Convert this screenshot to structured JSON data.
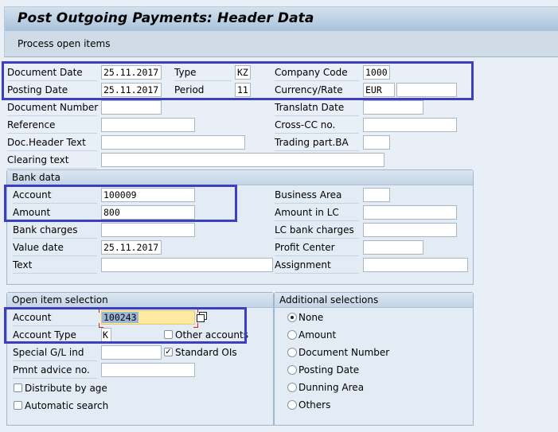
{
  "title": "Post Outgoing Payments: Header Data",
  "toolbar": {
    "process_open_items": "Process open items"
  },
  "header": {
    "document_date": {
      "label": "Document Date",
      "value": "25.11.2017"
    },
    "posting_date": {
      "label": "Posting Date",
      "value": "25.11.2017"
    },
    "type": {
      "label": "Type",
      "value": "KZ"
    },
    "period": {
      "label": "Period",
      "value": "11"
    },
    "company_code": {
      "label": "Company Code",
      "value": "1000"
    },
    "currency_rate": {
      "label": "Currency/Rate",
      "currency": "EUR",
      "rate": ""
    },
    "document_number": {
      "label": "Document Number",
      "value": ""
    },
    "translatn_date": {
      "label": "Translatn Date",
      "value": ""
    },
    "reference": {
      "label": "Reference",
      "value": ""
    },
    "cross_cc_no": {
      "label": "Cross-CC no.",
      "value": ""
    },
    "doc_header_text": {
      "label": "Doc.Header Text",
      "value": ""
    },
    "trading_part_ba": {
      "label": "Trading part.BA",
      "value": ""
    },
    "clearing_text": {
      "label": "Clearing text",
      "value": ""
    }
  },
  "bank_data": {
    "title": "Bank data",
    "account": {
      "label": "Account",
      "value": "100009"
    },
    "amount": {
      "label": "Amount",
      "value": "800"
    },
    "bank_charges": {
      "label": "Bank charges",
      "value": ""
    },
    "value_date": {
      "label": "Value date",
      "value": "25.11.2017"
    },
    "text": {
      "label": "Text",
      "value": ""
    },
    "business_area": {
      "label": "Business Area",
      "value": ""
    },
    "amount_in_lc": {
      "label": "Amount in LC",
      "value": ""
    },
    "lc_bank_charges": {
      "label": "LC bank charges",
      "value": ""
    },
    "profit_center": {
      "label": "Profit Center",
      "value": ""
    },
    "assignment": {
      "label": "Assignment",
      "value": ""
    }
  },
  "open_item_selection": {
    "title": "Open item selection",
    "account": {
      "label": "Account",
      "value": "100243"
    },
    "account_type": {
      "label": "Account Type",
      "value": "K"
    },
    "other_accounts": {
      "label": "Other accounts",
      "checked": false
    },
    "special_gl_ind": {
      "label": "Special G/L ind",
      "value": ""
    },
    "standard_ois": {
      "label": "Standard OIs",
      "checked": true
    },
    "pmnt_advice_no": {
      "label": "Pmnt advice no.",
      "value": ""
    },
    "distribute_by_age": {
      "label": "Distribute by age",
      "checked": false
    },
    "automatic_search": {
      "label": "Automatic search",
      "checked": false
    }
  },
  "additional_selections": {
    "title": "Additional selections",
    "selected": "None",
    "options": [
      "None",
      "Amount",
      "Document Number",
      "Posting Date",
      "Dunning Area",
      "Others"
    ]
  },
  "colors": {
    "highlight_box": "#3c3fc2",
    "focus_field": "#fde9a1"
  }
}
